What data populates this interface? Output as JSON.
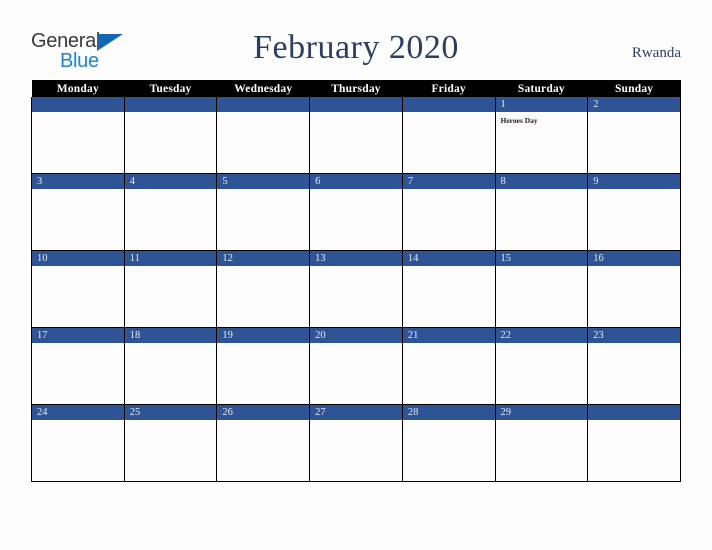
{
  "brand": {
    "name_top": "General",
    "name_bottom": "Blue",
    "triangle_color": "#1566b0",
    "top_color": "#3a3a3a",
    "bottom_color": "#1b84d6"
  },
  "header": {
    "title": "February 2020",
    "country": "Rwanda",
    "title_color": "#2d3e63"
  },
  "calendar": {
    "month": "February",
    "year": "2020",
    "weekday_headers": [
      "Monday",
      "Tuesday",
      "Wednesday",
      "Thursday",
      "Friday",
      "Saturday",
      "Sunday"
    ],
    "header_bg": "#000000",
    "band_color": "#2e5496",
    "weeks": [
      [
        {
          "day": "",
          "events": []
        },
        {
          "day": "",
          "events": []
        },
        {
          "day": "",
          "events": []
        },
        {
          "day": "",
          "events": []
        },
        {
          "day": "",
          "events": []
        },
        {
          "day": "1",
          "events": [
            "Heroes Day"
          ]
        },
        {
          "day": "2",
          "events": []
        }
      ],
      [
        {
          "day": "3",
          "events": []
        },
        {
          "day": "4",
          "events": []
        },
        {
          "day": "5",
          "events": []
        },
        {
          "day": "6",
          "events": []
        },
        {
          "day": "7",
          "events": []
        },
        {
          "day": "8",
          "events": []
        },
        {
          "day": "9",
          "events": []
        }
      ],
      [
        {
          "day": "10",
          "events": []
        },
        {
          "day": "11",
          "events": []
        },
        {
          "day": "12",
          "events": []
        },
        {
          "day": "13",
          "events": []
        },
        {
          "day": "14",
          "events": []
        },
        {
          "day": "15",
          "events": []
        },
        {
          "day": "16",
          "events": []
        }
      ],
      [
        {
          "day": "17",
          "events": []
        },
        {
          "day": "18",
          "events": []
        },
        {
          "day": "19",
          "events": []
        },
        {
          "day": "20",
          "events": []
        },
        {
          "day": "21",
          "events": []
        },
        {
          "day": "22",
          "events": []
        },
        {
          "day": "23",
          "events": []
        }
      ],
      [
        {
          "day": "24",
          "events": []
        },
        {
          "day": "25",
          "events": []
        },
        {
          "day": "26",
          "events": []
        },
        {
          "day": "27",
          "events": []
        },
        {
          "day": "28",
          "events": []
        },
        {
          "day": "29",
          "events": []
        },
        {
          "day": "",
          "events": []
        }
      ]
    ]
  }
}
